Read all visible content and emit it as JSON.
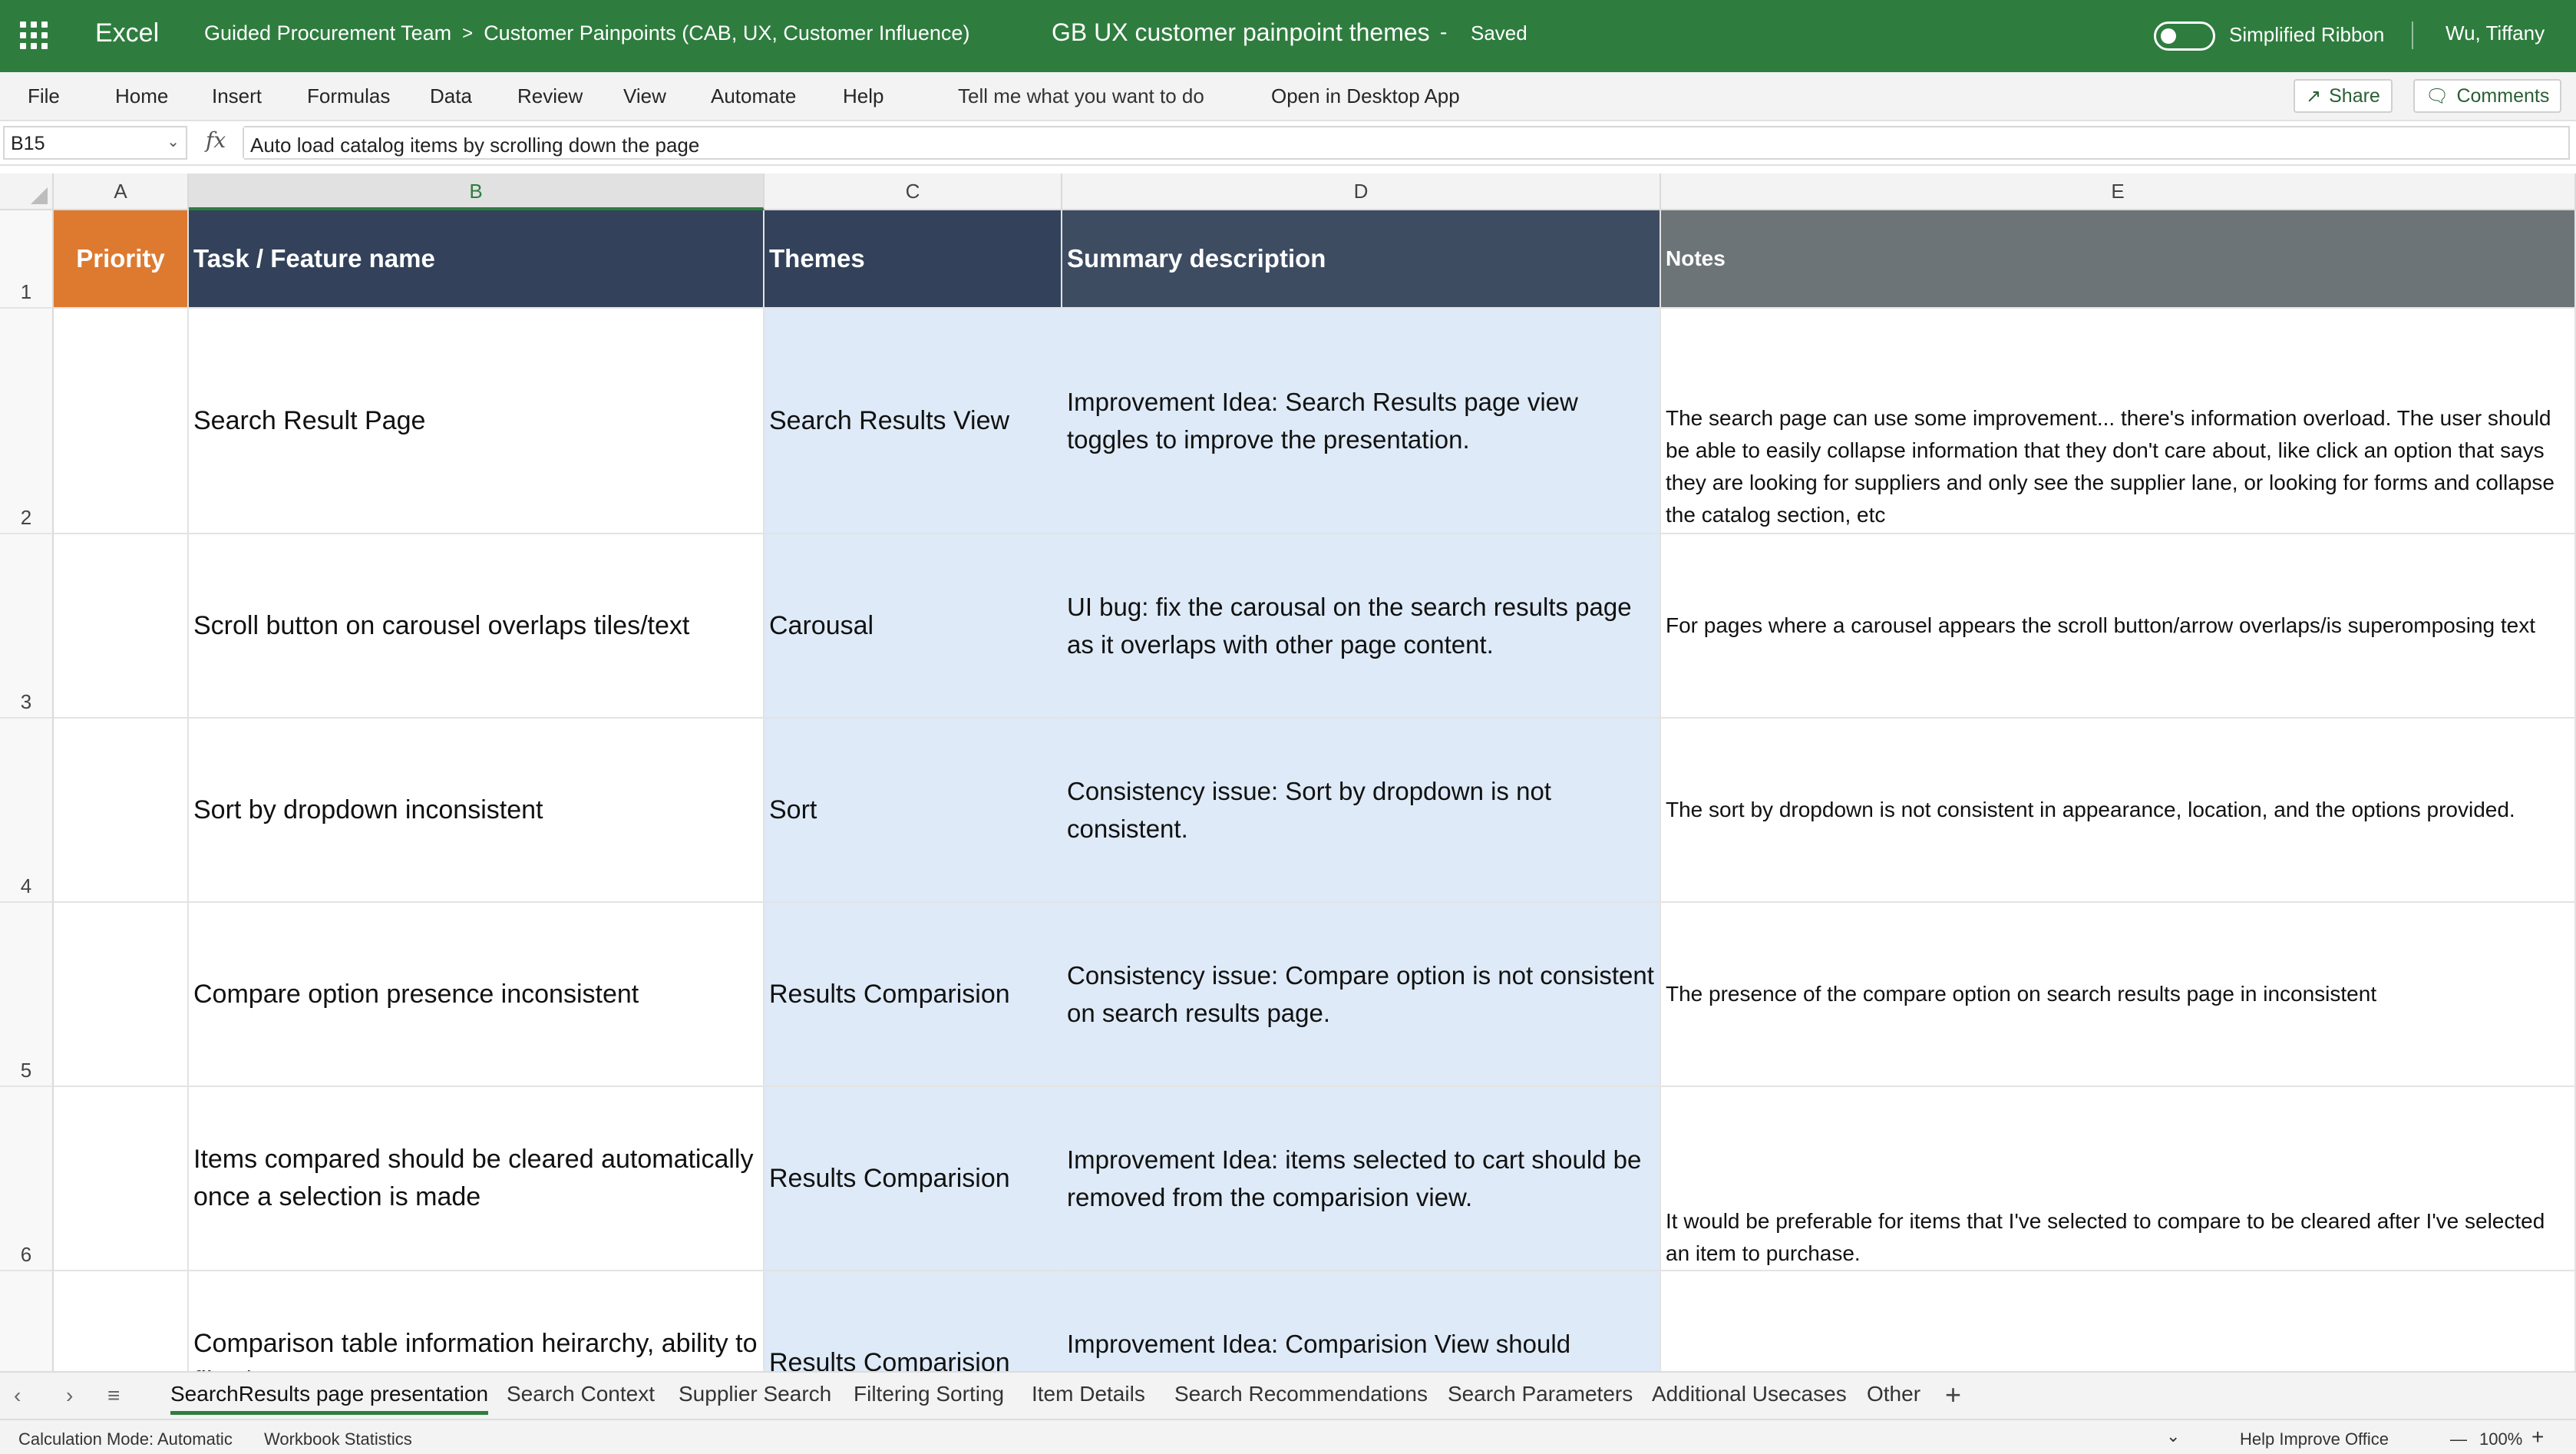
{
  "titlebar": {
    "app_name": "Excel",
    "breadcrumb": [
      "Guided Procurement Team",
      "Customer Painpoints (CAB, UX, Customer Influence)"
    ],
    "breadcrumb_separator": ">",
    "doc_title": "GB UX customer painpoint themes",
    "doc_separator": "-",
    "doc_status": "Saved",
    "toggle_label": "Simplified Ribbon",
    "toggle_on": false,
    "user": "Wu, Tiffany",
    "icons": [
      "app-launcher-icon"
    ]
  },
  "menu": {
    "items": [
      "File",
      "Home",
      "Insert",
      "Formulas",
      "Data",
      "Review",
      "View",
      "Automate",
      "Help"
    ],
    "tell_me": "Tell me what you want to do",
    "open_desktop": "Open in Desktop App",
    "share": "Share",
    "comments": "Comments",
    "icons": [
      "share-icon",
      "comments-icon"
    ]
  },
  "formula_bar": {
    "name_box": "B15",
    "fx": "fx",
    "formula": "Auto load catalog items by scrolling down the page"
  },
  "grid": {
    "column_headers": [
      "A",
      "B",
      "C",
      "D",
      "E"
    ],
    "selected_column": "B",
    "header_row": {
      "row_number": "1",
      "cells": [
        "Priority",
        "Task / Feature name",
        "Themes",
        "Summary description",
        "Notes"
      ]
    },
    "rows": [
      {
        "row_number": "2",
        "priority": "",
        "task": "Search Result Page",
        "theme": "Search Results View",
        "summary": "Improvement Idea: Search Results page view toggles to improve the presentation.",
        "notes": "The search page can use some improvement... there's information overload.  The user should be able to easily collapse information that they don't care about, like click an option that says they are looking for suppliers and only see the supplier lane, or looking for forms and collapse the catalog section, etc"
      },
      {
        "row_number": "3",
        "priority": "",
        "task": "Scroll button on carousel overlaps tiles/text",
        "theme": "Carousal",
        "summary": "UI bug: fix the carousal on the search results page as it overlaps with other page content.",
        "notes": "For pages where a carousel appears the scroll button/arrow overlaps/is superomposing text"
      },
      {
        "row_number": "4",
        "priority": "",
        "task": "Sort by dropdown inconsistent",
        "theme": "Sort",
        "summary": "Consistency issue: Sort by dropdown is not consistent.",
        "notes": "The sort by dropdown is not consistent in appearance, location, and the options provided."
      },
      {
        "row_number": "5",
        "priority": "",
        "task": "Compare option presence inconsistent",
        "theme": "Results Comparision",
        "summary": "Consistency issue: Compare option is not consistent on search results page.",
        "notes": "The presence of the compare option on search results page in inconsistent"
      },
      {
        "row_number": "6",
        "priority": "",
        "task": "Items compared should be cleared automatically once a selection is made",
        "theme": "Results Comparision",
        "summary": "Improvement Idea: items selected to cart should be removed from the comparision view.",
        "notes": " It would be preferable for items that I've selected to compare to be cleared after I've selected an item to purchase."
      },
      {
        "row_number": "7",
        "priority": "",
        "task": "Comparison table information heirarchy, ability to filter/sort",
        "theme": "Results Comparision",
        "summary": "Improvement Idea: Comparision View should display item information by relevancy",
        "notes": ""
      }
    ]
  },
  "sheet_tabs": {
    "tabs": [
      "SearchResults page presentation",
      "Search Context",
      "Supplier Search",
      "Filtering Sorting",
      "Item Details",
      "Search Recommendations",
      "Search Parameters",
      "Additional Usecases",
      "Other"
    ],
    "active": "SearchResults page presentation",
    "add_label": "+",
    "icons": [
      "tab-prev-icon",
      "tab-next-icon",
      "all-sheets-icon"
    ]
  },
  "status_bar": {
    "calc_mode": "Calculation Mode: Automatic",
    "workbook_stats": "Workbook Statistics",
    "help_improve": "Help Improve Office",
    "zoom": "100%",
    "zoom_minus": "—",
    "zoom_plus": "+"
  },
  "colors": {
    "brand_green": "#2e7d3e",
    "header_orange": "#dd7a30",
    "header_navy": "#33425a",
    "header_gray": "#6d7478",
    "theme_fill": "#deeaf7"
  }
}
